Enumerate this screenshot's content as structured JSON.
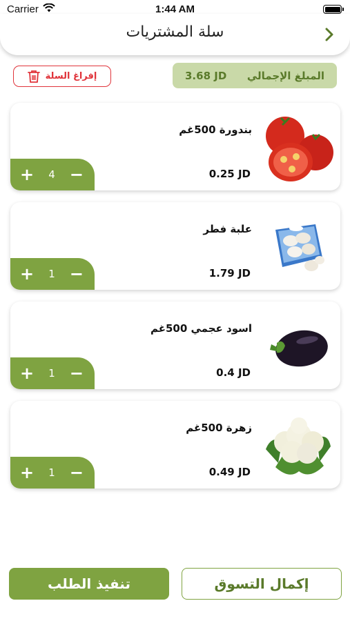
{
  "status_bar": {
    "carrier": "Carrier",
    "time": "1:44 AM"
  },
  "header": {
    "title": "سلة المشتريات"
  },
  "summary": {
    "total_label": "المبلغ الإجمالي",
    "total_value": "3.68 JD",
    "clear_label": "إفراغ السلة"
  },
  "items": [
    {
      "name": "بندورة 500غم",
      "price": "0.25 JD",
      "qty": "4",
      "icon": "tomato-icon"
    },
    {
      "name": "علبة فطر",
      "price": "1.79 JD",
      "qty": "1",
      "icon": "mushroom-box-icon"
    },
    {
      "name": "اسود عجمي 500غم",
      "price": "0.4 JD",
      "qty": "1",
      "icon": "eggplant-icon"
    },
    {
      "name": "زهرة 500غم",
      "price": "0.49 JD",
      "qty": "1",
      "icon": "cauliflower-icon"
    }
  ],
  "footer": {
    "submit_label": "تنفيذ الطلب",
    "continue_label": "إكمال التسوق"
  },
  "colors": {
    "accent": "#7fa341",
    "danger": "#e0333a",
    "total_bg": "#c9d9a8"
  }
}
